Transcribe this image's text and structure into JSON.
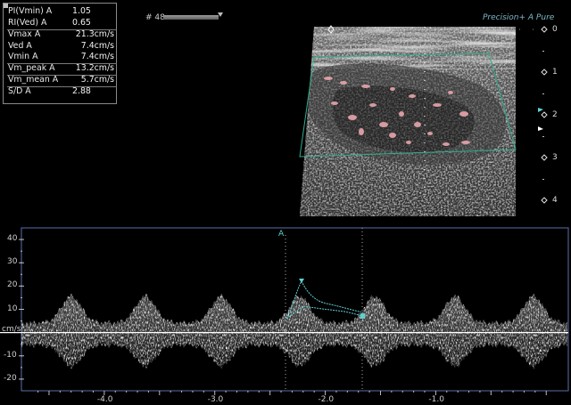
{
  "measurements": [
    {
      "label": "PI(Vmin) A",
      "value": "1.05"
    },
    {
      "label": "RI(Ved) A",
      "value": "0.65"
    },
    {
      "label": "Vmax A",
      "value": "21.3cm/s"
    },
    {
      "label": "Ved A",
      "value": "7.4cm/s"
    },
    {
      "label": "Vmin A",
      "value": "7.4cm/s"
    },
    {
      "label": "Vm_peak A",
      "value": "13.2cm/s"
    },
    {
      "label": "Vm_mean A",
      "value": "5.7cm/s"
    },
    {
      "label": "S/D A",
      "value": "2.88"
    }
  ],
  "frame": {
    "label": "# 48"
  },
  "brand": {
    "text": "Precision+ A Pure"
  },
  "depth_scale": {
    "labels": [
      "0",
      "1",
      "2",
      "3",
      "4"
    ]
  },
  "spectral": {
    "unit_label": "cm/s",
    "trace_marker": "A",
    "velocity_axis": {
      "ticks": [
        "40",
        "30",
        "20",
        "10",
        "-10",
        "-20"
      ],
      "values": [
        40,
        30,
        20,
        10,
        -10,
        -20
      ],
      "range": [
        -25,
        45
      ]
    },
    "time_axis": {
      "ticks": [
        "-4.0",
        "-3.0",
        "-2.0",
        "-1.0"
      ],
      "values": [
        -4.0,
        -3.0,
        -2.0,
        -1.0
      ],
      "range": [
        -4.75,
        0.2
      ]
    }
  },
  "colors": {
    "panel_border": "#8a8a8a",
    "color_box": "#2fae8f",
    "spectral_frame": "#5a6fa8",
    "trace": "#5fd0d0",
    "baseline": "#ffffff"
  }
}
